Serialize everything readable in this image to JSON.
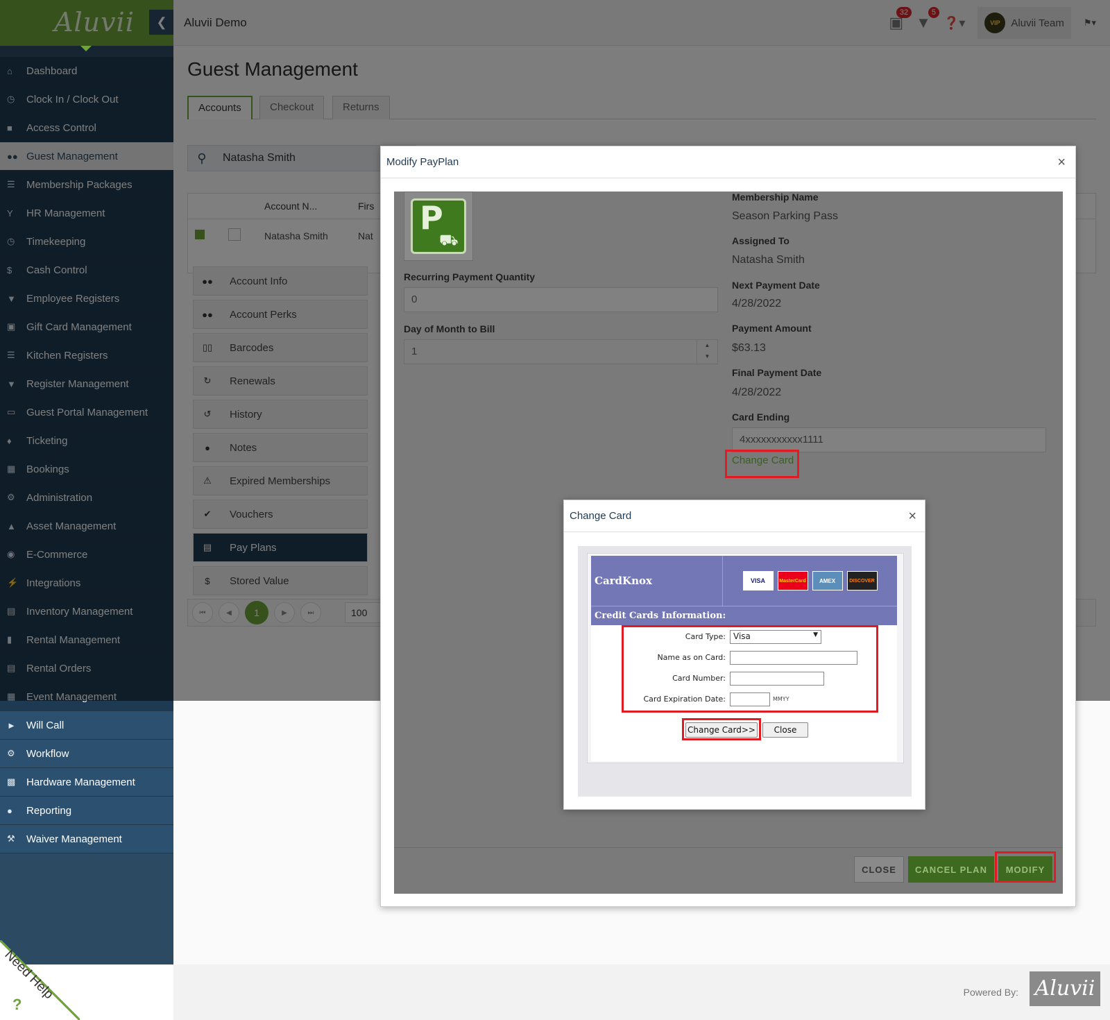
{
  "app": {
    "logo": "Aluvii",
    "window_title": "Aluvii Demo",
    "notifications_count": "32",
    "cart_count": "5",
    "user_name": "Aluvii Team",
    "vip_badge": "VIP"
  },
  "sidebar": {
    "items": [
      {
        "label": "Dashboard",
        "icon": "home-icon"
      },
      {
        "label": "Clock In / Clock Out",
        "icon": "clock-icon"
      },
      {
        "label": "Access Control",
        "icon": "lock-icon"
      },
      {
        "label": "Guest Management",
        "icon": "users-icon"
      },
      {
        "label": "Membership Packages",
        "icon": "list-icon"
      },
      {
        "label": "HR Management",
        "icon": "glass-icon"
      },
      {
        "label": "Timekeeping",
        "icon": "clock-icon"
      },
      {
        "label": "Cash Control",
        "icon": "dollar-icon"
      },
      {
        "label": "Employee Registers",
        "icon": "cart-icon"
      },
      {
        "label": "Gift Card Management",
        "icon": "gift-icon"
      },
      {
        "label": "Kitchen Registers",
        "icon": "list-icon"
      },
      {
        "label": "Register Management",
        "icon": "cart-icon"
      },
      {
        "label": "Guest Portal Management",
        "icon": "laptop-icon"
      },
      {
        "label": "Ticketing",
        "icon": "ticket-icon"
      },
      {
        "label": "Bookings",
        "icon": "calendar-icon"
      },
      {
        "label": "Administration",
        "icon": "cogs-icon"
      },
      {
        "label": "Asset Management",
        "icon": "cubes-icon"
      },
      {
        "label": "E-Commerce",
        "icon": "globe-icon"
      },
      {
        "label": "Integrations",
        "icon": "bolt-icon"
      },
      {
        "label": "Inventory Management",
        "icon": "archive-icon"
      },
      {
        "label": "Rental Management",
        "icon": "clipboard-icon"
      },
      {
        "label": "Rental Orders",
        "icon": "file-icon"
      },
      {
        "label": "Event Management",
        "icon": "calendar-icon"
      },
      {
        "label": "Will Call",
        "icon": "megaphone-icon"
      },
      {
        "label": "Workflow",
        "icon": "gear-icon"
      },
      {
        "label": "Hardware Management",
        "icon": "printer-icon"
      },
      {
        "label": "Reporting",
        "icon": "lightbulb-icon"
      },
      {
        "label": "Waiver Management",
        "icon": "gavel-icon"
      }
    ]
  },
  "page": {
    "title": "Guest Management",
    "tabs": [
      "Accounts",
      "Checkout",
      "Returns"
    ],
    "search_value": "Natasha Smith",
    "grid": {
      "headers": [
        "Account N...",
        "Firs"
      ],
      "row": [
        "Natasha Smith",
        "Nat"
      ]
    },
    "menu": [
      "Account Info",
      "Account Perks",
      "Barcodes",
      "Renewals",
      "History",
      "Notes",
      "Expired Memberships",
      "Vouchers",
      "Pay Plans",
      "Stored Value"
    ],
    "pager": {
      "current": "1",
      "page_size": "100"
    }
  },
  "modify_payplan": {
    "title": "Modify PayPlan",
    "membership_name_label": "Membership Name",
    "membership_name": "Season Parking Pass",
    "assigned_to_label": "Assigned To",
    "assigned_to": "Natasha Smith",
    "next_payment_label": "Next Payment Date",
    "next_payment": "4/28/2022",
    "payment_amount_label": "Payment Amount",
    "payment_amount": "$63.13",
    "final_payment_label": "Final Payment Date",
    "final_payment": "4/28/2022",
    "card_ending_label": "Card Ending",
    "card_ending": "4xxxxxxxxxxx1111",
    "change_card_link": "Change Card",
    "recurring_qty_label": "Recurring Payment Quantity",
    "recurring_qty": "0",
    "day_of_month_label": "Day of Month to Bill",
    "day_of_month": "1",
    "close_btn": "CLOSE",
    "cancel_btn": "CANCEL PLAN",
    "modify_btn": "MODIFY"
  },
  "change_card": {
    "title": "Change Card",
    "brand": "CardKnox",
    "cards": [
      "VISA",
      "MasterCard",
      "AMEX",
      "DISCOVER"
    ],
    "section": "Credit Cards Information:",
    "card_type_label": "Card Type:",
    "card_type_value": "Visa",
    "name_label": "Name as on Card:",
    "number_label": "Card Number:",
    "expiry_label": "Card Expiration Date:",
    "expiry_hint": "MMYY",
    "submit_btn": "Change Card>>",
    "close_btn": "Close"
  },
  "footer": {
    "powered_by": "Powered By:",
    "logo": "Aluvii",
    "need_help": "Need Help"
  },
  "colors": {
    "brand_green": "#6fa33b",
    "sidebar_navy": "#1e3a52",
    "highlight_red": "#e11b22",
    "cardknox_purple": "#7377b5"
  }
}
